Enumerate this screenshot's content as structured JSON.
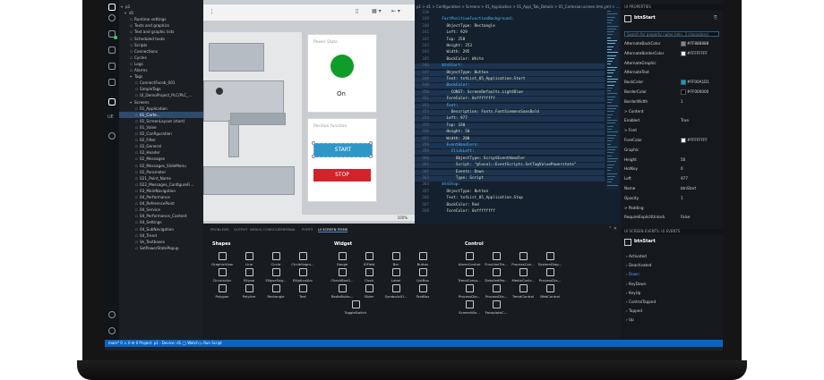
{
  "explorer": {
    "items": [
      "p1",
      "d1",
      "Runtime settings",
      "Texts and graphics",
      "Text and graphic lists",
      "Scheduled tasks",
      "Scripts",
      "Connections",
      "Cycles",
      "Logs",
      "Alarms",
      "Tags",
      "ConnectFaceb_001",
      "SimpleTags",
      "UI_DemoProject_PLC/PLC_...",
      "Screens",
      "01_Application",
      "01_Carte...",
      "01_ScreenLayout (start)",
      "01_Valve",
      "02_Configuration",
      "02_Filter",
      "02_General",
      "02_Header",
      "02_Messages",
      "02_Messages_SlideMenu",
      "02_Parameter",
      "021_Point_Name",
      "022_Messages_ConfigureFi...",
      "03_MainNavigation",
      "04_Performance",
      "04_ReferencePoint",
      "04_Service",
      "04_Performance_Content",
      "04_Settings",
      "04_SubNavigation",
      "04_Trend",
      "Ve_Textboxes",
      "SetPowerStatePopup"
    ]
  },
  "canvas": {
    "power_state_title": "Power State",
    "on_label": "On",
    "position_function_title": "Position function",
    "start_label": "START",
    "stop_label": "STOP",
    "zoom": "100%"
  },
  "code": {
    "breadcrumb": "p1 > d1 > Configuration > Screens > 01_Application > 01_Appl_Tab_Details > 01_Cartesian.screen.hmi.yml > ...",
    "lines": [
      {
        "n": "338",
        "t": "",
        "hl": false
      },
      {
        "n": "339",
        "t": "    FactPositionFunctionBackground:",
        "hl": false
      },
      {
        "n": "340",
        "t": "      ObjectType: Rectangle",
        "hl": false
      },
      {
        "n": "341",
        "t": "      Left: 929",
        "hl": false
      },
      {
        "n": "342",
        "t": "      Top: 258",
        "hl": false
      },
      {
        "n": "343",
        "t": "      Height: 253",
        "hl": false
      },
      {
        "n": "344",
        "t": "      Width: 295",
        "hl": false
      },
      {
        "n": "345",
        "t": "      BackColor: White",
        "hl": false
      },
      {
        "n": "346",
        "t": "    btnStart:",
        "hl": true
      },
      {
        "n": "347",
        "t": "      ObjectType: Button",
        "hl": true
      },
      {
        "n": "348",
        "t": "      Text: txtList_05_Application.Start",
        "hl": true
      },
      {
        "n": "349",
        "t": "      BackColor:",
        "hl": true
      },
      {
        "n": "350",
        "t": "        CONST: ScreenDefaults.LightBlue",
        "hl": true
      },
      {
        "n": "351",
        "t": "      ForeColor: 0xffffffff",
        "hl": true
      },
      {
        "n": "352",
        "t": "      Font:",
        "hl": true
      },
      {
        "n": "353",
        "t": "        Description: Fonts.FontSiemensSansBold",
        "hl": true
      },
      {
        "n": "354",
        "t": "      Left: 977",
        "hl": true
      },
      {
        "n": "355",
        "t": "      Top: 330",
        "hl": true
      },
      {
        "n": "356",
        "t": "      Height: 50",
        "hl": true
      },
      {
        "n": "357",
        "t": "      Width: 200",
        "hl": true
      },
      {
        "n": "358",
        "t": "      EventHandlers:",
        "hl": true
      },
      {
        "n": "359",
        "t": "        ClickLeft:",
        "hl": true
      },
      {
        "n": "360",
        "t": "          ObjectType: ScriptEventHandler",
        "hl": true
      },
      {
        "n": "361",
        "t": "          Script: \"@local::EventScripts.SetTagValuePowerstate\"",
        "hl": true
      },
      {
        "n": "362",
        "t": "          Events: Down",
        "hl": true
      },
      {
        "n": "363",
        "t": "          Type: Script",
        "hl": true
      },
      {
        "n": "364",
        "t": "    btnStop:",
        "hl": false
      },
      {
        "n": "365",
        "t": "      ObjectType: Button",
        "hl": false
      },
      {
        "n": "366",
        "t": "      Text: txtList_05_Application.Stop",
        "hl": false
      },
      {
        "n": "367",
        "t": "      BackColor: Red",
        "hl": false
      },
      {
        "n": "368",
        "t": "      ForeColor: 0xffffffff",
        "hl": false
      }
    ]
  },
  "properties": {
    "header": "UI PROPERTIES",
    "object_name": "btnStart",
    "search_placeholder": "Search for property name (min. 3 characters)",
    "rows": [
      {
        "name": "AlternateBackColor",
        "value": "#FF888888",
        "swatch": "#888888"
      },
      {
        "name": "AlternateBorderColor",
        "value": "#FFFFFFFF",
        "swatch": "#ffffff"
      },
      {
        "name": "AlternateGraphic",
        "value": "",
        "swatch": ""
      },
      {
        "name": "AlternateText",
        "value": "",
        "swatch": ""
      },
      {
        "name": "BackColor",
        "value": "#FF00A1D1",
        "swatch": "#00a1d1"
      },
      {
        "name": "BorderColor",
        "value": "#FF000000",
        "swatch": "#000000"
      },
      {
        "name": "BorderWidth",
        "value": "1",
        "swatch": ""
      },
      {
        "name": "> Content",
        "value": "",
        "swatch": ""
      },
      {
        "name": "Enabled",
        "value": "True",
        "swatch": ""
      },
      {
        "name": "> Font",
        "value": "",
        "swatch": ""
      },
      {
        "name": "ForeColor",
        "value": "#FFFFFFFF",
        "swatch": "#ffffff"
      },
      {
        "name": "Graphic",
        "value": "",
        "swatch": ""
      },
      {
        "name": "Height",
        "value": "50",
        "swatch": ""
      },
      {
        "name": "HotKey",
        "value": "0",
        "swatch": ""
      },
      {
        "name": "Left",
        "value": "977",
        "swatch": ""
      },
      {
        "name": "Name",
        "value": "btnStart",
        "swatch": ""
      },
      {
        "name": "Opacity",
        "value": "1",
        "swatch": ""
      },
      {
        "name": "> Padding",
        "value": "",
        "swatch": ""
      },
      {
        "name": "RequireExplicitUnlock",
        "value": "False",
        "swatch": ""
      }
    ],
    "events_header": "UI SCREEN EVENTS: UI EVENTS",
    "events_object": "btnStart",
    "events": [
      "Activated",
      "Deactivated",
      "Down",
      "KeyDown",
      "KeyUp",
      "ControlTapped",
      "Tapped",
      "Up"
    ]
  },
  "bottom": {
    "tabs": [
      "PROBLEMS",
      "OUTPUT",
      "DEBUG CONSOLE",
      "TERMINAL",
      "PORTS",
      "UI SCREEN ITEMS"
    ],
    "sections": {
      "shapes": {
        "title": "Shapes",
        "items": [
          "GraphicView",
          "Line",
          "Circle",
          "CircleSegm...",
          "CircularArc",
          "Ellipse",
          "EllipseSeg...",
          "EllipticalArc",
          "Polygon",
          "Polyline",
          "Rectangle",
          "Text"
        ]
      },
      "widget": {
        "title": "Widget",
        "items": [
          "Gauge",
          "IOField",
          "Bar",
          "Button",
          "CheckBoxG...",
          "Clock",
          "Label",
          "ListBox",
          "RadioButto...",
          "Slider",
          "SymbolicIO...",
          "TextBox",
          "ToggleSwitch"
        ]
      },
      "control": {
        "title": "Control",
        "items": [
          "AlarmControl",
          "FunctionTre...",
          "ProcessCon...",
          "SystemDiag...",
          "TrendComp...",
          "DetailedPar...",
          "MediaContr...",
          "ProcessDia...",
          "ProcessDia...",
          "ProcessDia...",
          "TrendControl",
          "WebControl",
          "ScreenWin...",
          "FaceplateC..."
        ]
      }
    }
  },
  "statusbar": {
    "text": "main*  0 ⚠ 0  ⚙ 0  Project: p1 - Device: d1  ◯ Watch  ▷ Run Script"
  }
}
